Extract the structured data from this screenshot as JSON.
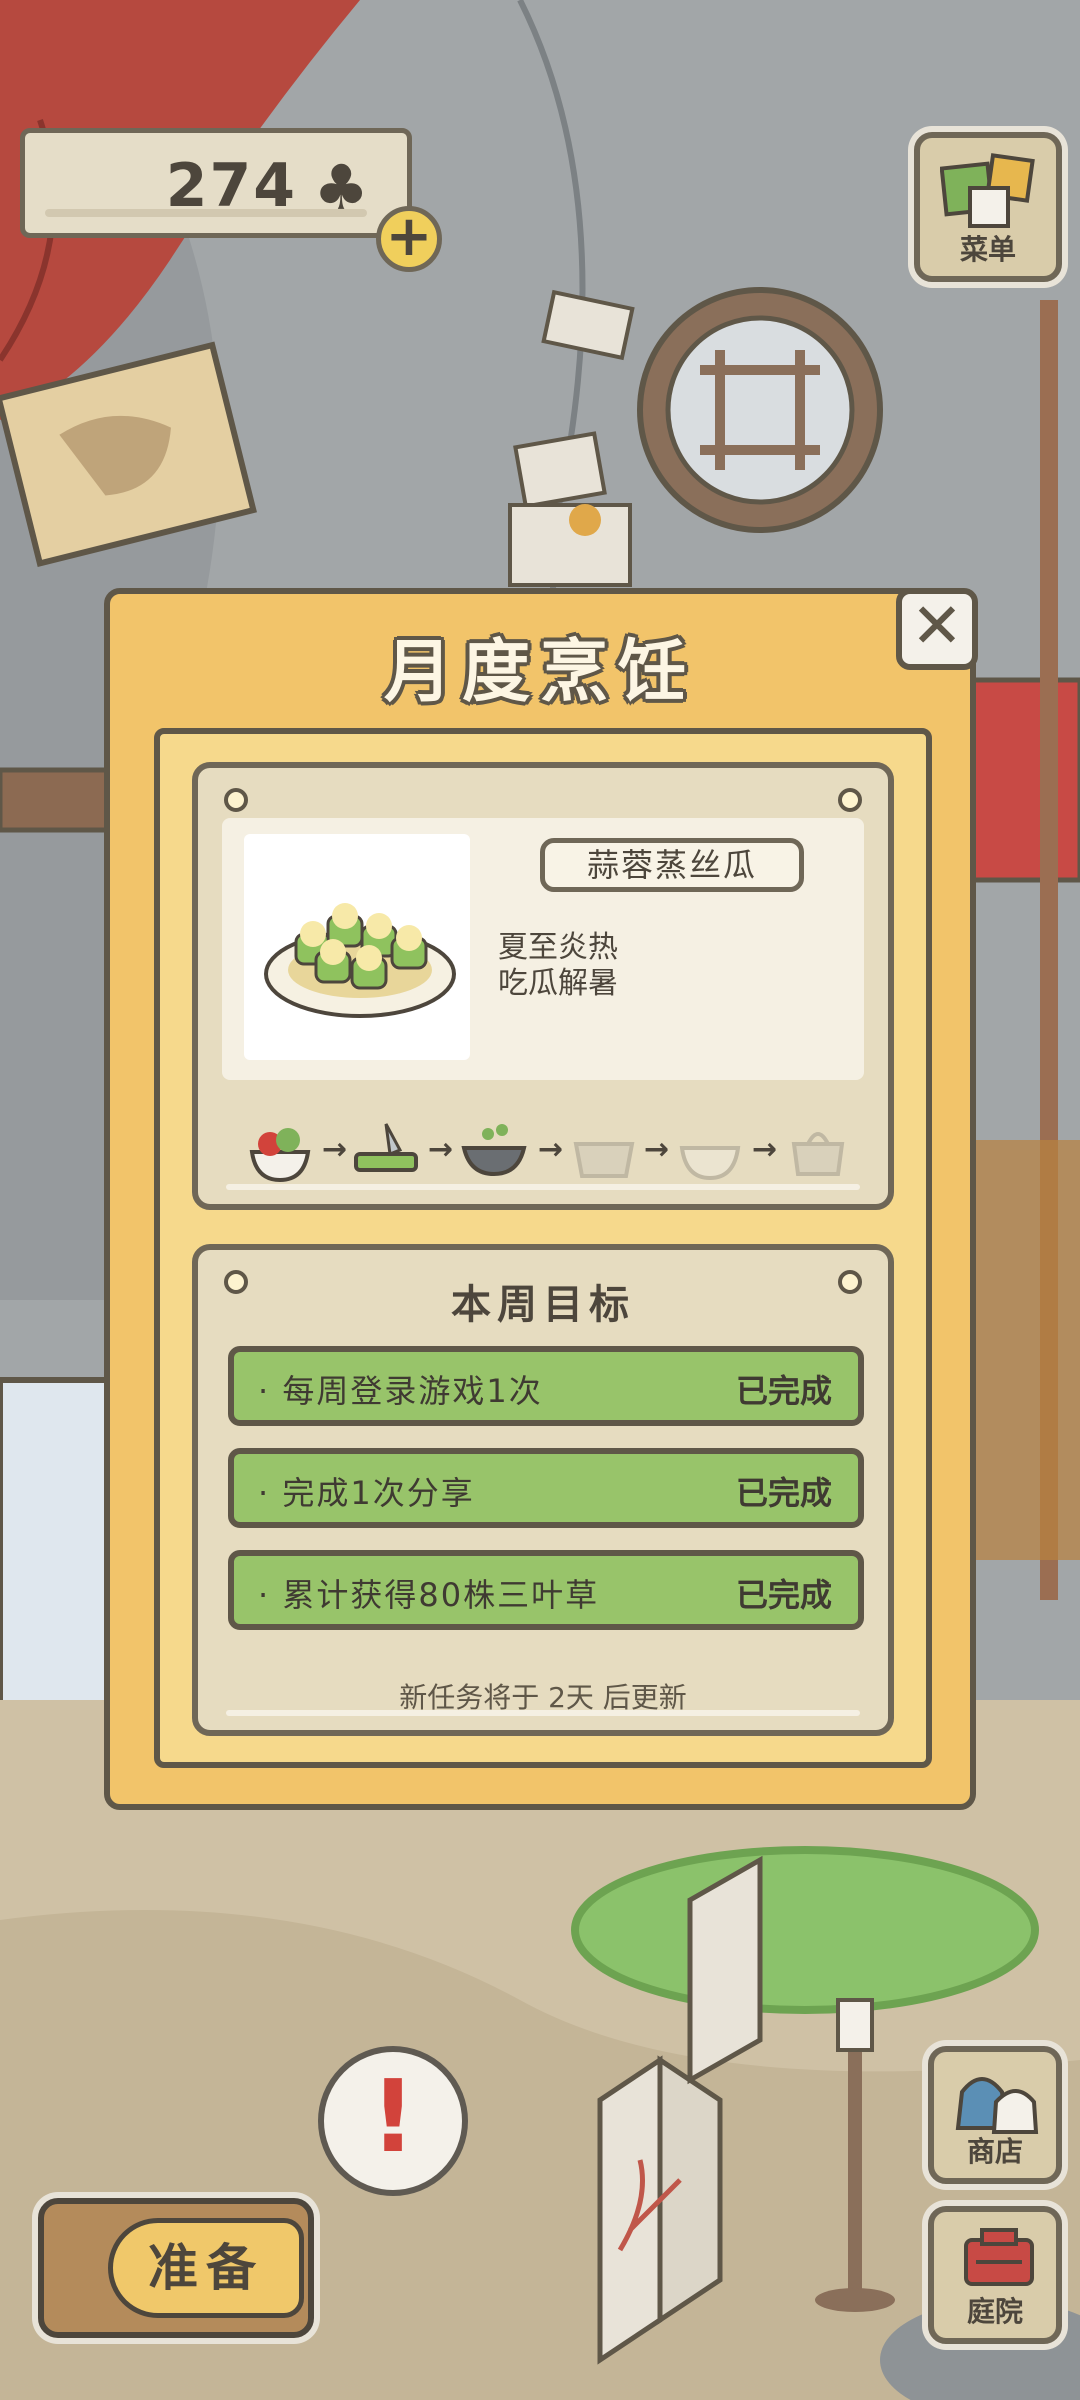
{
  "counter": {
    "value": "274",
    "currency_icon": "clover-icon",
    "plus_icon": "plus-icon"
  },
  "menu_button": {
    "label": "菜单",
    "icon": "notes-icon"
  },
  "shop_button": {
    "label": "商店",
    "icon": "bags-icon"
  },
  "yard_button": {
    "label": "庭院",
    "icon": "mailbox-icon"
  },
  "prepare_button": {
    "label": "准备"
  },
  "alert_bubble": {
    "glyph": "!"
  },
  "modal": {
    "title": "月度烹饪",
    "close_glyph": "✕",
    "recipe": {
      "name": "蒜蓉蒸丝瓜",
      "description_line1": "夏至炎热",
      "description_line2": "吃瓜解暑",
      "steps": [
        "vegetables-icon",
        "chopping-icon",
        "wok-icon",
        "steamer-icon",
        "bowl-icon",
        "bag-icon"
      ],
      "steps_done": 3
    },
    "goals": {
      "title": "本周目标",
      "items": [
        {
          "text": "· 每周登录游戏1次",
          "status": "已完成"
        },
        {
          "text": "· 完成1次分享",
          "status": "已完成"
        },
        {
          "text": "· 累计获得80株三叶草",
          "status": "已完成"
        }
      ],
      "renew_note": "新任务将于 2天 后更新"
    }
  },
  "colors": {
    "panel": "#f2c46a",
    "goal_done": "#98c46a",
    "outline": "#5f5748",
    "card": "#e6dcc0"
  }
}
